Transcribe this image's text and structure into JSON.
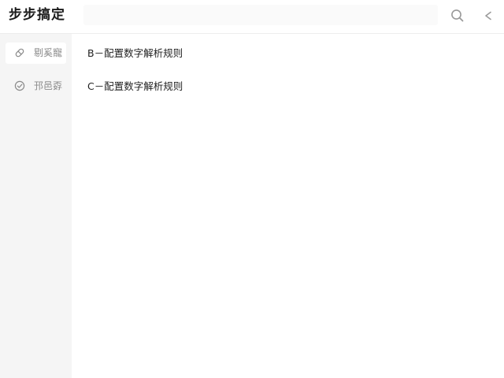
{
  "header": {
    "title": "步步搞定",
    "search": {
      "value": "",
      "placeholder": ""
    },
    "search_icon": "search-icon",
    "collapse_icon": "chevron-left-icon"
  },
  "sidebar": {
    "items": [
      {
        "label": "剔奚寵",
        "icon": "pill-icon",
        "active": true
      },
      {
        "label": "邘邑孬",
        "icon": "check-circle-icon",
        "active": false
      }
    ]
  },
  "main": {
    "rules": [
      {
        "label": "B－配置数字解析规则"
      },
      {
        "label": "C－配置数字解析规则"
      }
    ]
  },
  "colors": {
    "sidebar_bg": "#f5f5f5",
    "active_item_bg": "#ffffff",
    "text": "#1f1f1f",
    "muted_text": "#8a8a8a"
  }
}
